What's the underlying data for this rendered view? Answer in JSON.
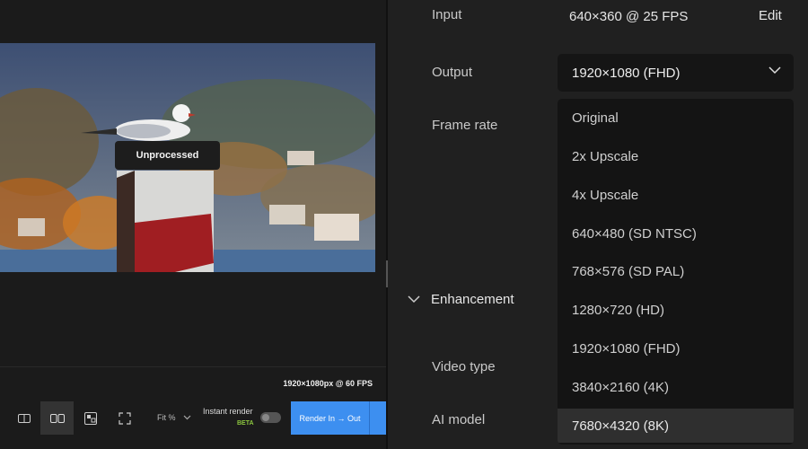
{
  "preview": {
    "tooltip": "Unprocessed",
    "resolution_info": "1920×1080px @ 60 FPS"
  },
  "toolbar": {
    "buttons": [
      {
        "icon": "split-view-icon"
      },
      {
        "icon": "side-by-side-icon",
        "active": true
      },
      {
        "icon": "compare-icon"
      },
      {
        "icon": "fullscreen-icon"
      }
    ],
    "fit_label": "Fit %",
    "instant_render_label": "Instant render",
    "beta_label": "BETA",
    "render_button_label": "Render In → Out"
  },
  "settings": {
    "input_label": "Input",
    "input_value": "640×360 @ 25 FPS",
    "edit_label": "Edit",
    "output_label": "Output",
    "output_value": "1920×1080 (FHD)",
    "frame_rate_label": "Frame rate",
    "enhancement_label": "Enhancement",
    "video_type_label": "Video type",
    "ai_model_label": "AI model"
  },
  "dropdown": {
    "options": [
      "Original",
      "2x Upscale",
      "4x Upscale",
      "640×480 (SD NTSC)",
      "768×576 (SD PAL)",
      "1280×720 (HD)",
      "1920×1080 (FHD)",
      "3840×2160 (4K)",
      "7680×4320 (8K)"
    ],
    "hovered_index": 8
  },
  "colors": {
    "accent": "#3d8ff0",
    "beta": "#8cc63f"
  }
}
